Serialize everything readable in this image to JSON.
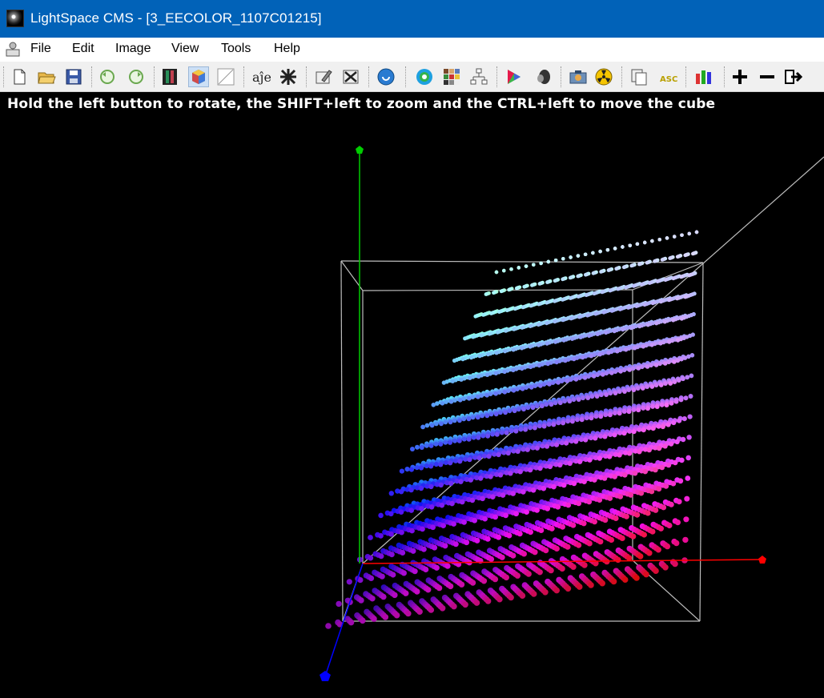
{
  "window": {
    "title": "LightSpace CMS - [3_EECOLOR_1107C01215]"
  },
  "menu": [
    {
      "label": "File"
    },
    {
      "label": "Edit"
    },
    {
      "label": "Image"
    },
    {
      "label": "View"
    },
    {
      "label": "Tools"
    },
    {
      "label": "Help"
    }
  ],
  "toolbar": {
    "icons": [
      "new-file-icon",
      "open-folder-icon",
      "save-icon",
      "undo-icon",
      "redo-icon",
      "film-strip-icon",
      "color-cube-icon",
      "graph-icon",
      "alje-icon",
      "grid-icon",
      "edit-icon",
      "close-file-icon",
      "globe-icon",
      "color-wheel-icon",
      "color-patches-icon",
      "network-icon",
      "triangle-gamut-icon",
      "probe-icon",
      "camera-icon",
      "radiation-icon",
      "copy-icon",
      "asc-icon",
      "bars-chart-icon",
      "plus-icon",
      "minus-icon",
      "export-icon"
    ],
    "selected": "color-cube-icon"
  },
  "hint": "Hold the left button to rotate, the SHIFT+left to zoom and the CTRL+left to move the cube",
  "colors": {
    "titlebar": "#0162b8",
    "x_axis": "#ff0000",
    "y_axis": "#00cc00",
    "z_axis": "#0000ff",
    "cube_edges": "#bdbdbd"
  }
}
